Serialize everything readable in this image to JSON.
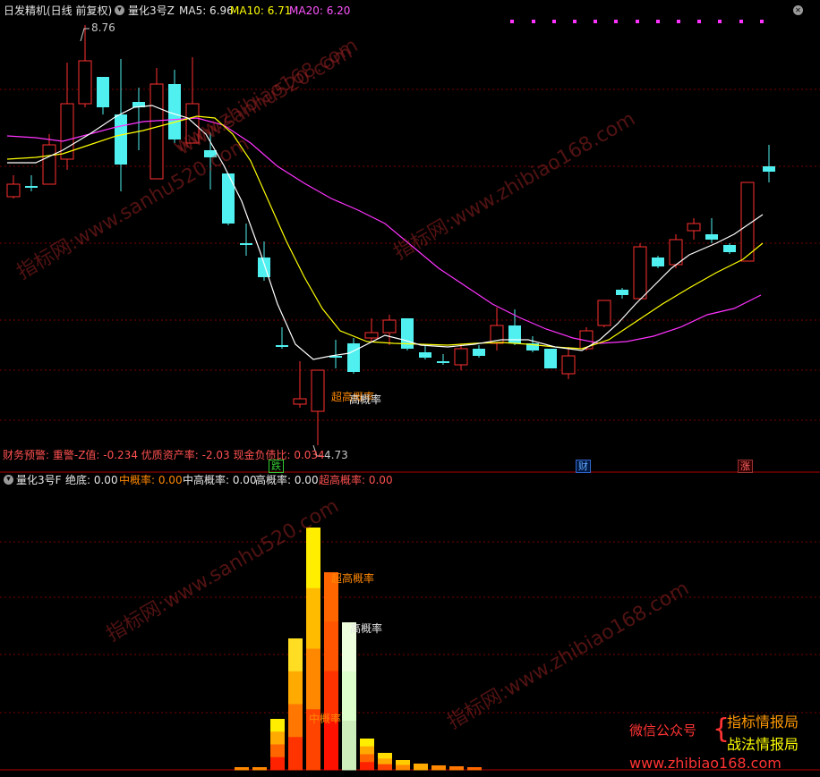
{
  "main_panel": {
    "title": "日发精机(日线 前复权)",
    "indicator": "量化3号Z",
    "ma5": "MA5: 6.96",
    "ma10": "MA10: 6.71",
    "ma20": "MA20: 6.20",
    "high_label": "8.76",
    "low_label": "4.73",
    "finance_warning": "财务预警: 重警-Z值: -0.234 优质资产率: -2.03 现金负债比: 0.034",
    "bar_text1": "超高概率",
    "bar_text2": "高概率",
    "colors": {
      "up": "#ff3030",
      "down": "#50f0f0",
      "ma5": "#ffffff",
      "ma10": "#ffff00",
      "ma20": "#ff33ff",
      "grid": "#8b0000"
    }
  },
  "markers": {
    "die": "跌",
    "cai": "财",
    "zhang": "涨"
  },
  "sub_panel": {
    "indicator": "量化3号F",
    "jue_di": "绝底: 0.00",
    "zhong_gailv": "中概率: 0.00",
    "zhong_gao": "中高概率: 0.00",
    "gao_gailv": "高概率: 0.00",
    "chao_gao": "超高概率: 0.00",
    "label_chao": "超高概率",
    "label_gao": "高概率",
    "label_zhong": "中概率"
  },
  "brand": {
    "wechat": "微信公众号",
    "line1": "指标情报局",
    "line2": "战法情报局",
    "site": "www.zhibiao168.com"
  },
  "watermarks": [
    "www.sanhu520.com",
    "www.zhibiao168.com",
    "指标网:www.sanhu520.com",
    "指标网:www.zhibiao168.com",
    "指标网:www.sanhu520.com",
    "指标网:www.zhibiao168.com"
  ]
}
